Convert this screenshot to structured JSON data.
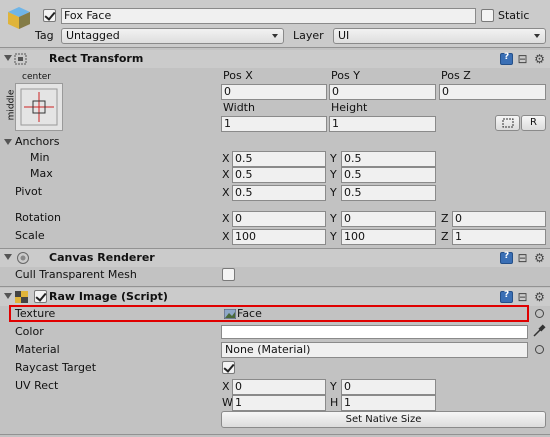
{
  "gameobject": {
    "active": true,
    "name": "Fox Face",
    "static_label": "Static",
    "static_checked": false,
    "tag_label": "Tag",
    "tag_value": "Untagged",
    "layer_label": "Layer",
    "layer_value": "UI"
  },
  "rect_transform": {
    "title": "Rect Transform",
    "anchor_top_label": "center",
    "anchor_side_label": "middle",
    "pos_x_label": "Pos X",
    "pos_x": "0",
    "pos_y_label": "Pos Y",
    "pos_y": "0",
    "pos_z_label": "Pos Z",
    "pos_z": "0",
    "width_label": "Width",
    "width": "1",
    "height_label": "Height",
    "height": "1",
    "r_button": "R",
    "anchors_label": "Anchors",
    "min_label": "Min",
    "min_x": "0.5",
    "min_y": "0.5",
    "max_label": "Max",
    "max_x": "0.5",
    "max_y": "0.5",
    "pivot_label": "Pivot",
    "pivot_x": "0.5",
    "pivot_y": "0.5",
    "rotation_label": "Rotation",
    "rot_x": "0",
    "rot_y": "0",
    "rot_z": "0",
    "scale_label": "Scale",
    "scale_x": "100",
    "scale_y": "100",
    "scale_z": "1",
    "x": "X",
    "y": "Y",
    "z": "Z"
  },
  "canvas_renderer": {
    "title": "Canvas Renderer",
    "cull_label": "Cull Transparent Mesh",
    "cull_checked": false
  },
  "raw_image": {
    "title": "Raw Image (Script)",
    "enabled": true,
    "texture_label": "Texture",
    "texture_value": "Face",
    "color_label": "Color",
    "material_label": "Material",
    "material_value": "None (Material)",
    "raycast_label": "Raycast Target",
    "raycast_checked": true,
    "uv_rect_label": "UV Rect",
    "uv_x_label": "X",
    "uv_x": "0",
    "uv_y_label": "Y",
    "uv_y": "0",
    "uv_w_label": "W",
    "uv_w": "1",
    "uv_h_label": "H",
    "uv_h": "1",
    "native_size_button": "Set Native Size"
  },
  "colors": {
    "highlight": "#e00000",
    "anchor_red": "#cc2222"
  },
  "icons": [
    "gameobject-cube-icon",
    "help-book-icon",
    "settings-gear-icon",
    "canvas-renderer-icon",
    "raw-image-icon",
    "object-picker-icon",
    "eyedropper-icon"
  ]
}
